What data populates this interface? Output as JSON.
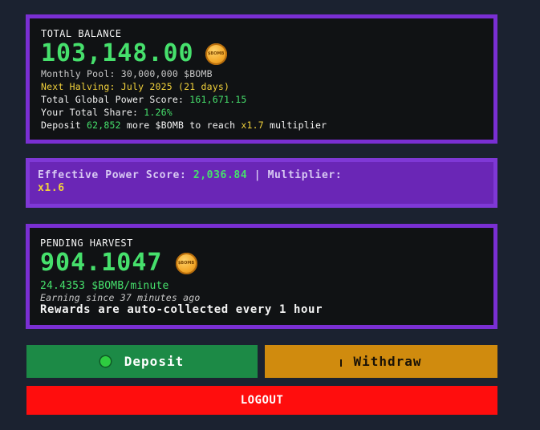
{
  "balance": {
    "title": "TOTAL BALANCE",
    "amount": "103,148.00",
    "coin_label": "$BOMB",
    "monthly_pool_label": "Monthly Pool:",
    "monthly_pool_value": "30,000,000 $BOMB",
    "next_halving": "Next Halving: July 2025 (21 days)",
    "global_power_label": "Total Global Power Score:",
    "global_power_value": "161,671.15",
    "share_label": "Your Total Share:",
    "share_value": "1.26%",
    "deposit_prefix": "Deposit",
    "deposit_amount": "62,852",
    "deposit_middle": "more $BOMB to reach",
    "deposit_multiplier": "x1.7",
    "deposit_suffix": "multiplier"
  },
  "power": {
    "label": "Effective Power Score:",
    "score": "2,036.84",
    "separator": "|",
    "multiplier_label": "Multiplier:",
    "multiplier_value": "x1.6"
  },
  "harvest": {
    "title": "PENDING HARVEST",
    "amount": "904.1047",
    "coin_label": "$BOMB",
    "rate": "24.4353 $BOMB/minute",
    "earning_since": "Earning since 37 minutes ago",
    "auto_collect": "Rewards are auto-collected every 1 hour"
  },
  "actions": {
    "deposit_label": "Deposit",
    "withdraw_label": "Withdraw",
    "logout_label": "LOGOUT"
  },
  "colors": {
    "background": "#1b2230",
    "card_border": "#7a2fd3",
    "green": "#46e06c",
    "yellow": "#f1d13b",
    "deposit_button": "#1c8a46",
    "withdraw_button": "#d08b0e",
    "logout_button": "#ff0d0d"
  },
  "icons": {
    "coin": "bomb-coin-icon",
    "deposit": "green-dot-icon",
    "withdraw": "bar-icon"
  }
}
